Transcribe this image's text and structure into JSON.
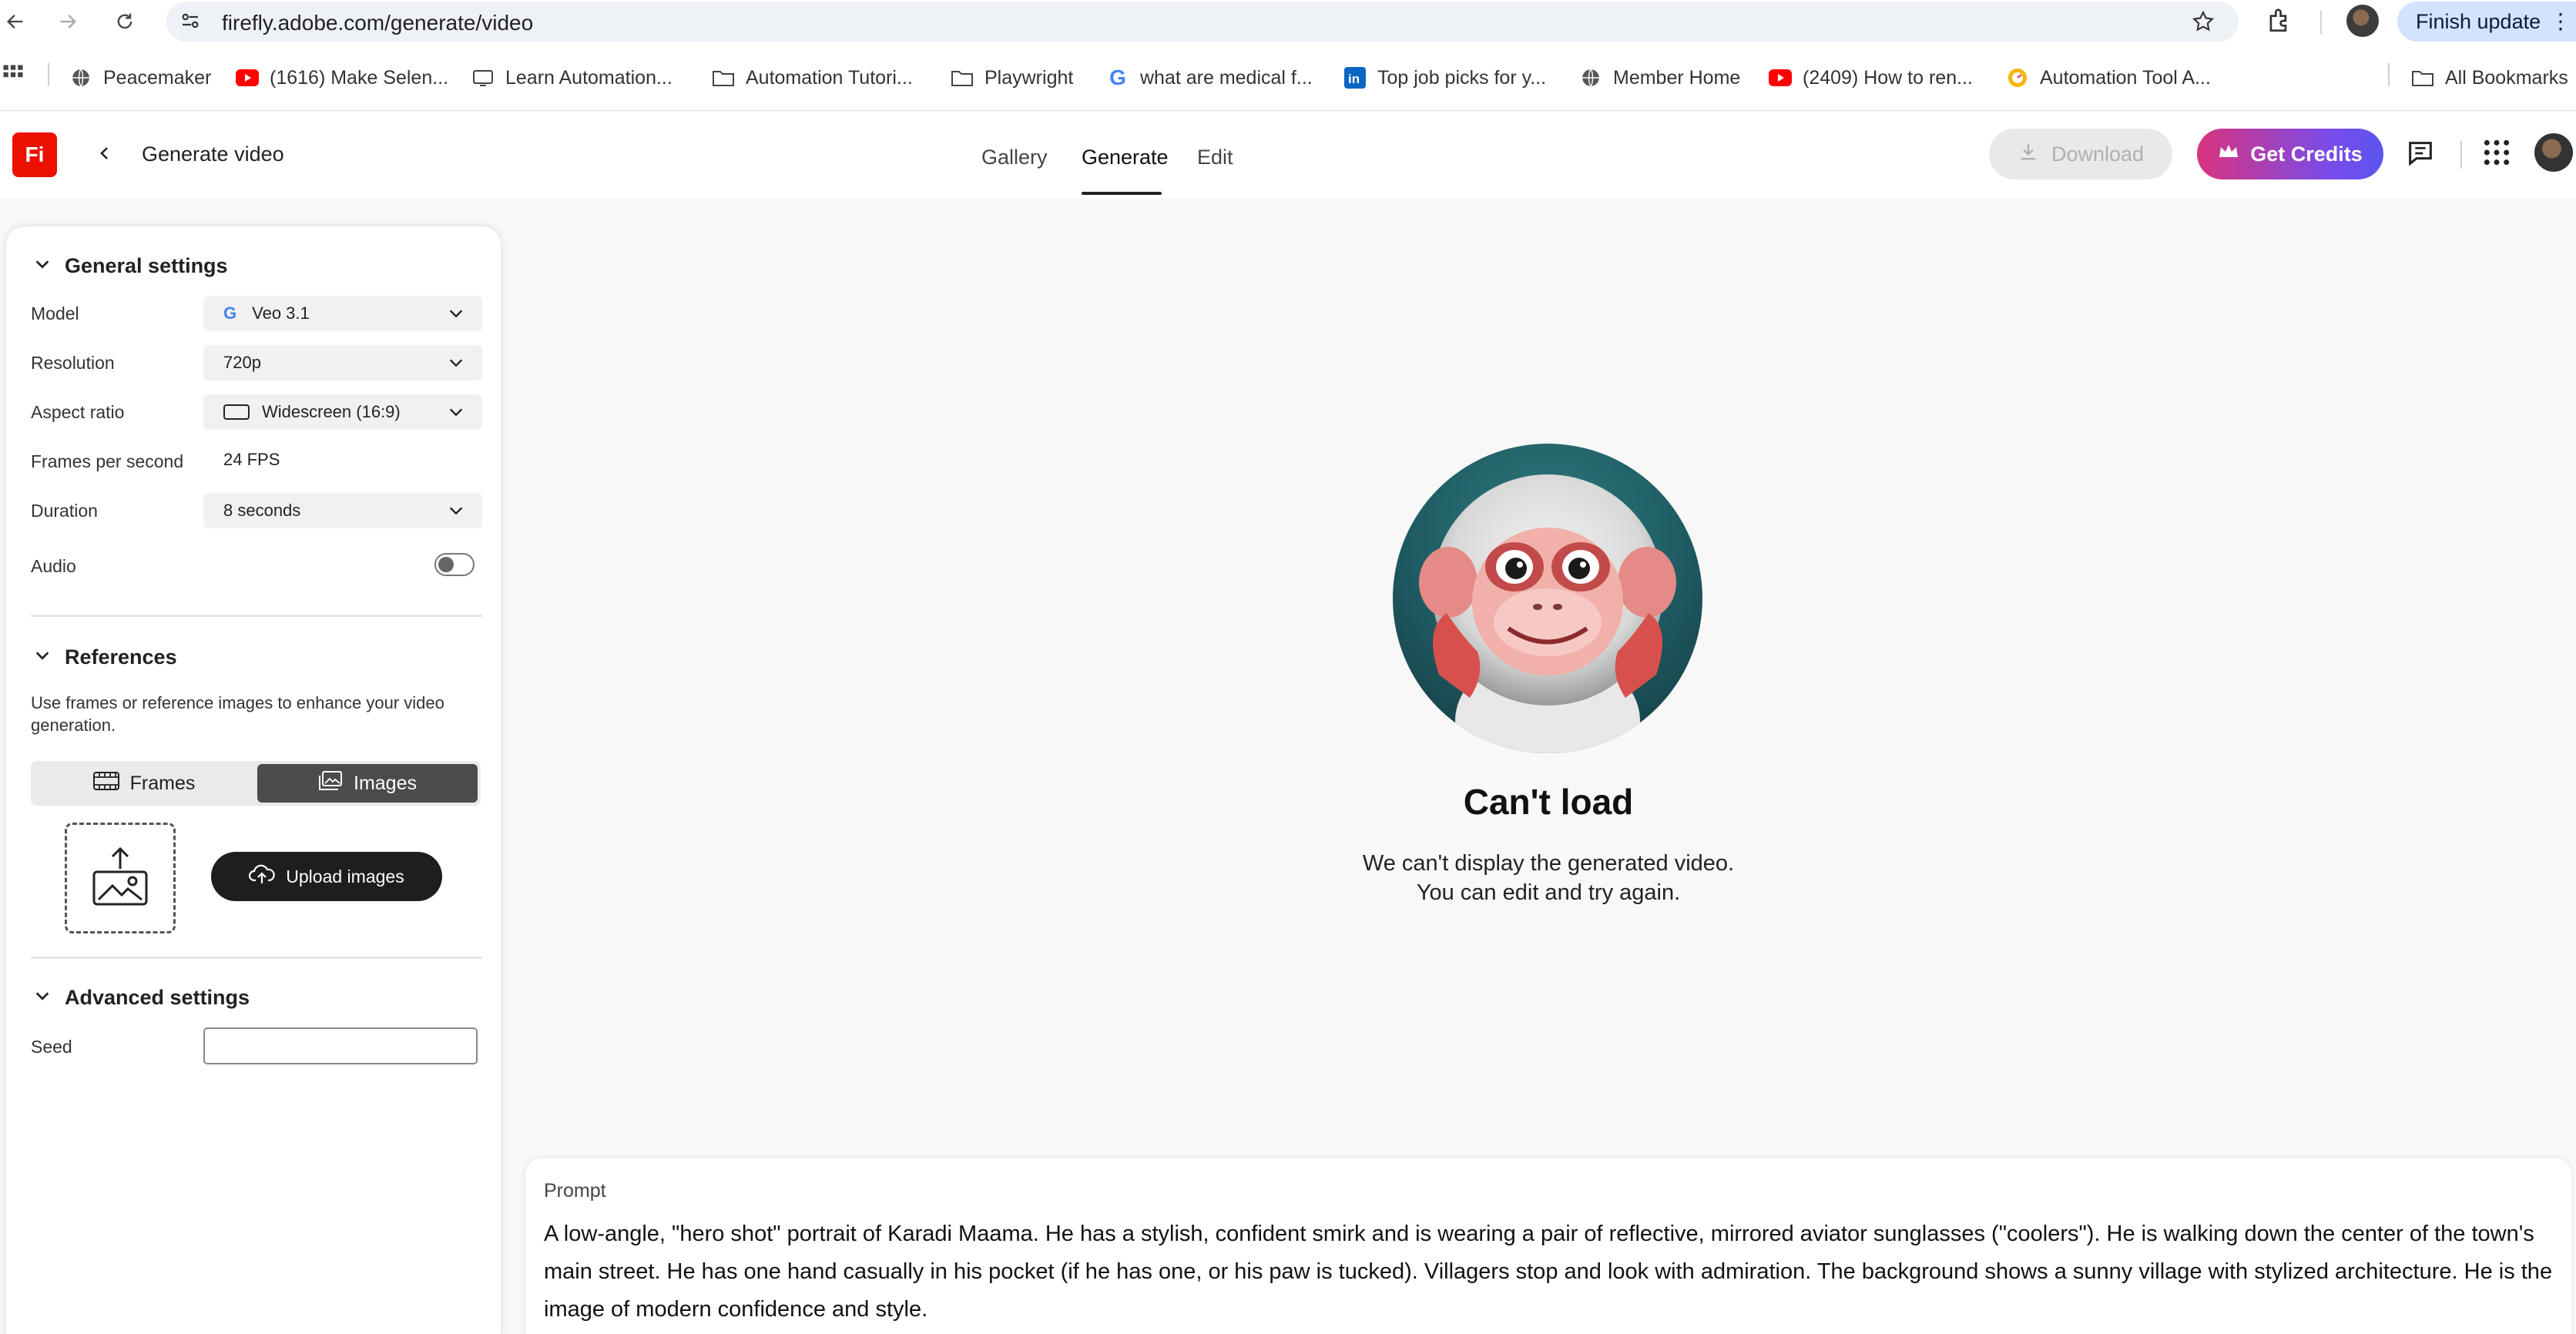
{
  "browser": {
    "url": "firefly.adobe.com/generate/video",
    "finish_update": "Finish update",
    "bookmarks": [
      {
        "label": "Peacemaker",
        "icon": "globe-icon"
      },
      {
        "label": "(1616) Make Selen...",
        "icon": "youtube-icon"
      },
      {
        "label": "Learn Automation...",
        "icon": "slides-icon"
      },
      {
        "label": "Automation Tutori...",
        "icon": "folder-icon"
      },
      {
        "label": "Playwright",
        "icon": "folder-icon"
      },
      {
        "label": "what are medical f...",
        "icon": "google-icon"
      },
      {
        "label": "Top job picks for y...",
        "icon": "linkedin-icon"
      },
      {
        "label": "Member Home",
        "icon": "globe-icon"
      },
      {
        "label": "(2409) How to ren...",
        "icon": "youtube-icon"
      },
      {
        "label": "Automation Tool A...",
        "icon": "gauge-icon"
      }
    ],
    "all_bookmarks": "All Bookmarks"
  },
  "header": {
    "logo": "Fi",
    "title": "Generate video",
    "tabs": [
      "Gallery",
      "Generate",
      "Edit"
    ],
    "active_tab": "Generate",
    "download": "Download",
    "get_credits": "Get Credits"
  },
  "settings": {
    "general_title": "General settings",
    "model_label": "Model",
    "model_value": "Veo 3.1",
    "resolution_label": "Resolution",
    "resolution_value": "720p",
    "aspect_label": "Aspect ratio",
    "aspect_value": "Widescreen (16:9)",
    "fps_label": "Frames per second",
    "fps_value": "24 FPS",
    "duration_label": "Duration",
    "duration_value": "8 seconds",
    "audio_label": "Audio",
    "audio_on": false,
    "references_title": "References",
    "references_desc": "Use frames or reference images to enhance your video generation.",
    "frames_tab": "Frames",
    "images_tab": "Images",
    "upload_images": "Upload images",
    "advanced_title": "Advanced settings",
    "seed_label": "Seed",
    "seed_value": ""
  },
  "main": {
    "error_title": "Can't load",
    "error_line1": "We can't display the generated video.",
    "error_line2": "You can edit and try again.",
    "prompt_label": "Prompt",
    "prompt_text": "A low-angle, \"hero shot\" portrait of Karadi Maama. He has a stylish, confident smirk and is wearing a pair of reflective, mirrored aviator sunglasses (\"coolers\"). He is walking down the center of the town's main street. He has one hand casually in his pocket (if he has one, or his paw is tucked). Villagers stop and look with admiration. The background shows a sunny village with stylized architecture. He is the image of modern confidence and style."
  },
  "colors": {
    "adobe_red": "#eb1000",
    "credits_gradient_start": "#d9337d",
    "credits_gradient_end": "#5b55f0"
  }
}
